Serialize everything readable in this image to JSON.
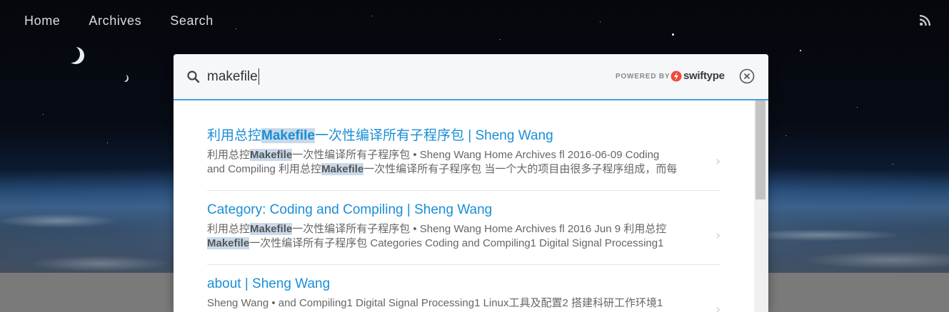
{
  "nav": {
    "items": [
      {
        "label": "Home"
      },
      {
        "label": "Archives"
      },
      {
        "label": "Search"
      }
    ],
    "rss_icon": "rss-icon"
  },
  "search": {
    "value": "makefile",
    "powered_by": "POWERED BY",
    "brand": "swiftype",
    "icons": {
      "search": "search-icon",
      "close": "close-circle-icon",
      "brand": "swiftype-bolt-icon"
    }
  },
  "results": [
    {
      "title_pre": "利用总控",
      "title_hl": "Makefile",
      "title_post": "一次性编译所有子程序包 | Sheng Wang",
      "line1_pre": "利用总控",
      "line1_hl": "Makefile",
      "line1_post": "一次性编译所有子程序包 • Sheng Wang Home Archives fl 2016-06-09 Coding",
      "line2_pre": "and Compiling 利用总控",
      "line2_hl": "Makefile",
      "line2_post": "一次性编译所有子程序包 当一个大的项目由很多子程序组成，而每"
    },
    {
      "title_pre": "Category: Coding and Compiling | Sheng Wang",
      "line1_pre": "利用总控",
      "line1_hl": "Makefile",
      "line1_post": "一次性编译所有子程序包 • Sheng Wang Home Archives fl 2016 Jun 9 利用总控",
      "line2_pre": "",
      "line2_hl": "Makefile",
      "line2_post": "一次性编译所有子程序包 Categories Coding and Compiling1 Digital Signal Processing1"
    },
    {
      "title_pre": "about | Sheng Wang",
      "line1_pre": "Sheng Wang • and Compiling1 Digital Signal Processing1 Linux工具及配置2 搭建科研工作环境1"
    }
  ],
  "colors": {
    "link": "#1a8ed6",
    "highlight": "#c8d9ea",
    "search_border": "#4a9fd8"
  }
}
